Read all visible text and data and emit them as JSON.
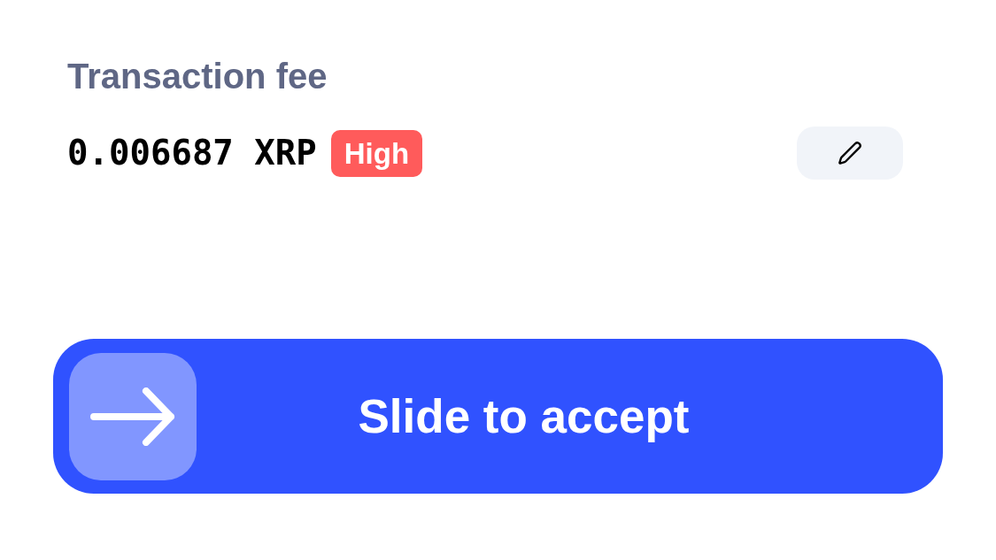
{
  "fee": {
    "label": "Transaction fee",
    "amount": "0.006687 XRP",
    "badge": "High"
  },
  "slider": {
    "label": "Slide to accept",
    "level": 0
  }
}
